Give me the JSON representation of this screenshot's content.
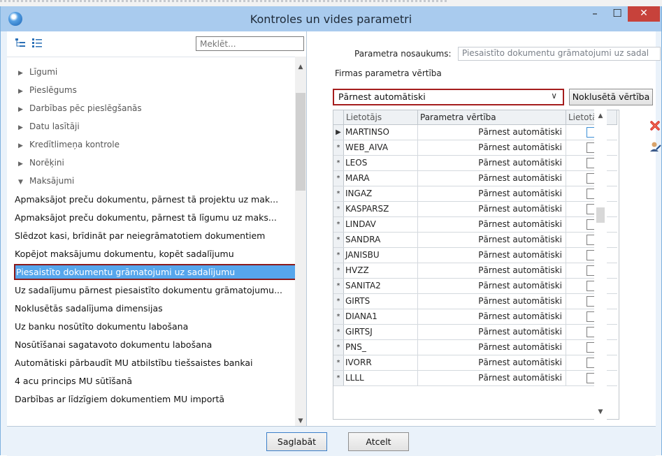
{
  "window": {
    "title": "Kontroles un vides parametri",
    "minimize": "–",
    "maximize": "☐",
    "close": "✕"
  },
  "left": {
    "search_placeholder": "Meklēt...",
    "categories": [
      {
        "label": "Līgumi",
        "expanded": false
      },
      {
        "label": "Pieslēgums",
        "expanded": false
      },
      {
        "label": "Darbības pēc pieslēgšanās",
        "expanded": false
      },
      {
        "label": "Datu lasītāji",
        "expanded": false
      },
      {
        "label": "Kredītlimeņa kontrole",
        "expanded": false
      },
      {
        "label": "Norēķini",
        "expanded": false
      },
      {
        "label": "Maksājumi",
        "expanded": true
      }
    ],
    "items": [
      "Apmaksājot preču dokumentu, pārnest tā projektu uz mak...",
      "Apmaksājot preču dokumentu, pārnest tā līgumu uz maks...",
      "Slēdzot kasi, brīdināt par neiegrāmatotiem dokumentiem",
      "Kopējot maksājumu dokumentu, kopēt sadalījumu",
      "Piesaistīto dokumentu grāmatojumi uz sadalījumu",
      "Uz sadalījumu pārnest piesaistīto dokumentu grāmatojumu...",
      "Noklusētās sadalījuma dimensijas",
      "Uz banku nosūtīto dokumentu labošana",
      "Nosūtīšanai sagatavoto dokumentu labošana",
      "Automātiski pārbaudīt MU atbilstību tiešsaistes bankai",
      "4 acu princips MU sūtīšanā",
      "Darbības ar līdzīgiem dokumentiem MU importā"
    ],
    "selected_index": 4
  },
  "right": {
    "param_name_label": "Parametra nosaukums:",
    "param_name_value": "Piesaistīto dokumentu grāmatojumi uz sadal",
    "firm_value_label": "Firmas parametra vērtība",
    "firm_value": "Pārnest automātiski",
    "default_button": "Noklusētā vērtība",
    "grid": {
      "columns": [
        "Lietotājs",
        "Parametra vērtība",
        "Lietotāja"
      ],
      "rows": [
        {
          "marker": "▶",
          "user": "MARTINSO",
          "value": "Pārnest automātiski"
        },
        {
          "marker": "*",
          "user": "WEB_AIVA",
          "value": "Pārnest automātiski"
        },
        {
          "marker": "*",
          "user": "LEOS",
          "value": "Pārnest automātiski"
        },
        {
          "marker": "*",
          "user": "MARA",
          "value": "Pārnest automātiski"
        },
        {
          "marker": "*",
          "user": "INGAZ",
          "value": "Pārnest automātiski"
        },
        {
          "marker": "*",
          "user": "KASPARSZ",
          "value": "Pārnest automātiski"
        },
        {
          "marker": "*",
          "user": "LINDAV",
          "value": "Pārnest automātiski"
        },
        {
          "marker": "*",
          "user": "SANDRA",
          "value": "Pārnest automātiski"
        },
        {
          "marker": "*",
          "user": "JANISBU",
          "value": "Pārnest automātiski"
        },
        {
          "marker": "*",
          "user": "HVZZ",
          "value": "Pārnest automātiski"
        },
        {
          "marker": "*",
          "user": "SANITA2",
          "value": "Pārnest automātiski"
        },
        {
          "marker": "*",
          "user": "GIRTS",
          "value": "Pārnest automātiski"
        },
        {
          "marker": "*",
          "user": "DIANA1",
          "value": "Pārnest automātiski"
        },
        {
          "marker": "*",
          "user": "GIRTSJ",
          "value": "Pārnest automātiski"
        },
        {
          "marker": "*",
          "user": "PNS_",
          "value": "Pārnest automātiski"
        },
        {
          "marker": "*",
          "user": "IVORR",
          "value": "Pārnest automātiski"
        },
        {
          "marker": "*",
          "user": "LLLL",
          "value": "Pārnest automātiski"
        }
      ]
    }
  },
  "footer": {
    "save": "Saglabāt",
    "cancel": "Atcelt"
  }
}
